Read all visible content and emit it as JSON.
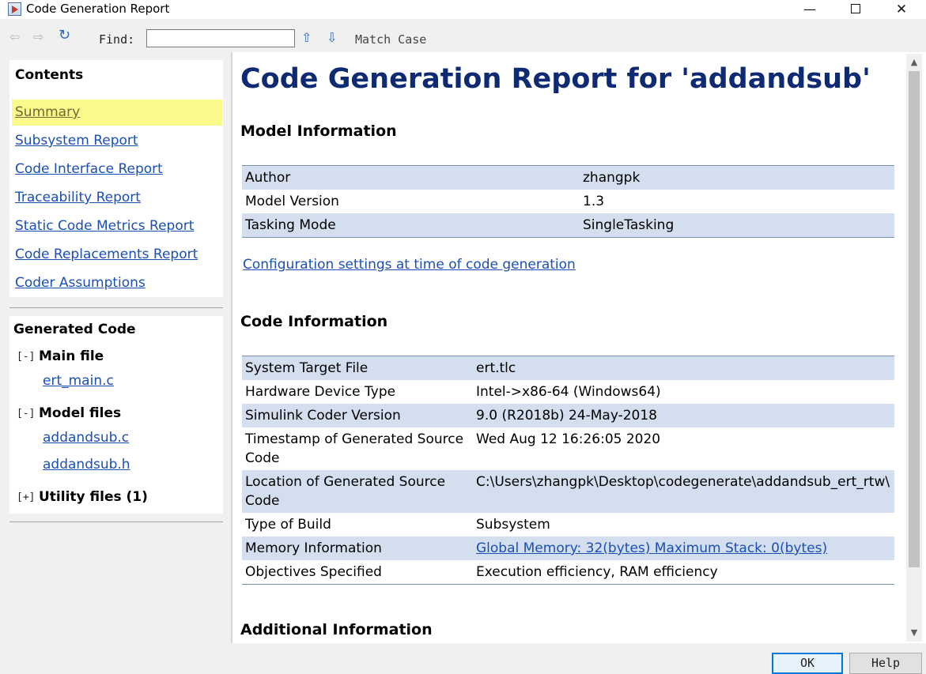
{
  "window": {
    "title": "Code Generation Report",
    "minimize": "—",
    "close": "✕"
  },
  "toolbar": {
    "find_label": "Find:",
    "find_value": "",
    "match_case": "Match Case"
  },
  "nav": {
    "contents_heading": "Contents",
    "items": [
      {
        "label": "Summary",
        "active": true
      },
      {
        "label": "Subsystem Report"
      },
      {
        "label": "Code Interface Report"
      },
      {
        "label": "Traceability Report"
      },
      {
        "label": "Static Code Metrics Report"
      },
      {
        "label": "Code Replacements Report"
      },
      {
        "label": "Coder Assumptions"
      }
    ],
    "generated_heading": "Generated Code",
    "groups": [
      {
        "toggle": "[-]",
        "label": "Main file",
        "files": [
          "ert_main.c"
        ]
      },
      {
        "toggle": "[-]",
        "label": "Model files",
        "files": [
          "addandsub.c",
          "addandsub.h"
        ]
      },
      {
        "toggle": "[+]",
        "label": "Utility files (1)",
        "files": []
      }
    ]
  },
  "report": {
    "title": "Code Generation Report for 'addandsub'",
    "model_info_heading": "Model Information",
    "model_info": [
      {
        "key": "Author",
        "value": "zhangpk"
      },
      {
        "key": "Model Version",
        "value": "1.3"
      },
      {
        "key": "Tasking Mode",
        "value": "SingleTasking"
      }
    ],
    "config_link": "Configuration settings at time of code generation",
    "code_info_heading": "Code Information",
    "code_info": [
      {
        "key": "System Target File",
        "value": "ert.tlc"
      },
      {
        "key": "Hardware Device Type",
        "value": "Intel->x86-64 (Windows64)"
      },
      {
        "key": "Simulink Coder Version",
        "value": "9.0 (R2018b) 24-May-2018"
      },
      {
        "key": "Timestamp of Generated Source Code",
        "value": "Wed Aug 12 16:26:05 2020"
      },
      {
        "key": "Location of Generated Source Code",
        "value": "C:\\Users\\zhangpk\\Desktop\\codegenerate\\addandsub_ert_rtw\\"
      },
      {
        "key": "Type of Build",
        "value": "Subsystem"
      },
      {
        "key": "Memory Information",
        "value": "Global Memory: 32(bytes) Maximum Stack: 0(bytes)"
      },
      {
        "key": "Objectives Specified",
        "value": "Execution efficiency, RAM efficiency"
      }
    ],
    "additional_heading": "Additional Information"
  },
  "buttons": {
    "ok": "OK",
    "help": "Help"
  },
  "colors": {
    "row_stripe": "#d3deee",
    "link": "#1a4fb5",
    "title": "#0d2a73",
    "nav_highlight": "#fafa8a"
  }
}
